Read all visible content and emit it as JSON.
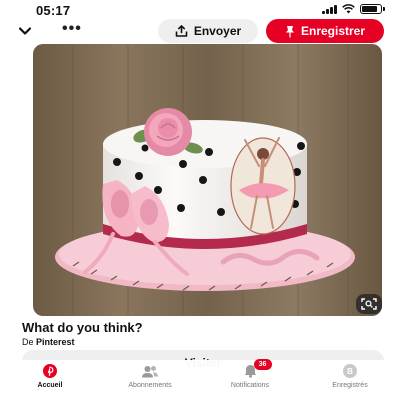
{
  "status_bar": {
    "time": "05:17"
  },
  "toolbar": {
    "back_icon": "chevron-down-icon",
    "more_icon": "more-icon",
    "send_label": "Envoyer",
    "send_icon": "share-icon",
    "save_label": "Enregistrer",
    "save_icon": "pin-icon",
    "save_color": "#e60023"
  },
  "pin": {
    "image_subject": "cake",
    "title": "What do you think?",
    "source_prefix": "De",
    "source_name": "Pinterest",
    "visit_label": "Visiter",
    "lens_icon": "visual-search-icon"
  },
  "bottom_nav": {
    "items": [
      {
        "label": "Accueil",
        "icon": "pinterest-logo-icon",
        "active": true
      },
      {
        "label": "Abonnements",
        "icon": "people-icon",
        "active": false
      },
      {
        "label": "Notifications",
        "icon": "bell-icon",
        "active": false,
        "badge": "36"
      },
      {
        "label": "Enregistrés",
        "icon": "profile-icon",
        "active": false,
        "avatar_letter": "B"
      }
    ]
  }
}
